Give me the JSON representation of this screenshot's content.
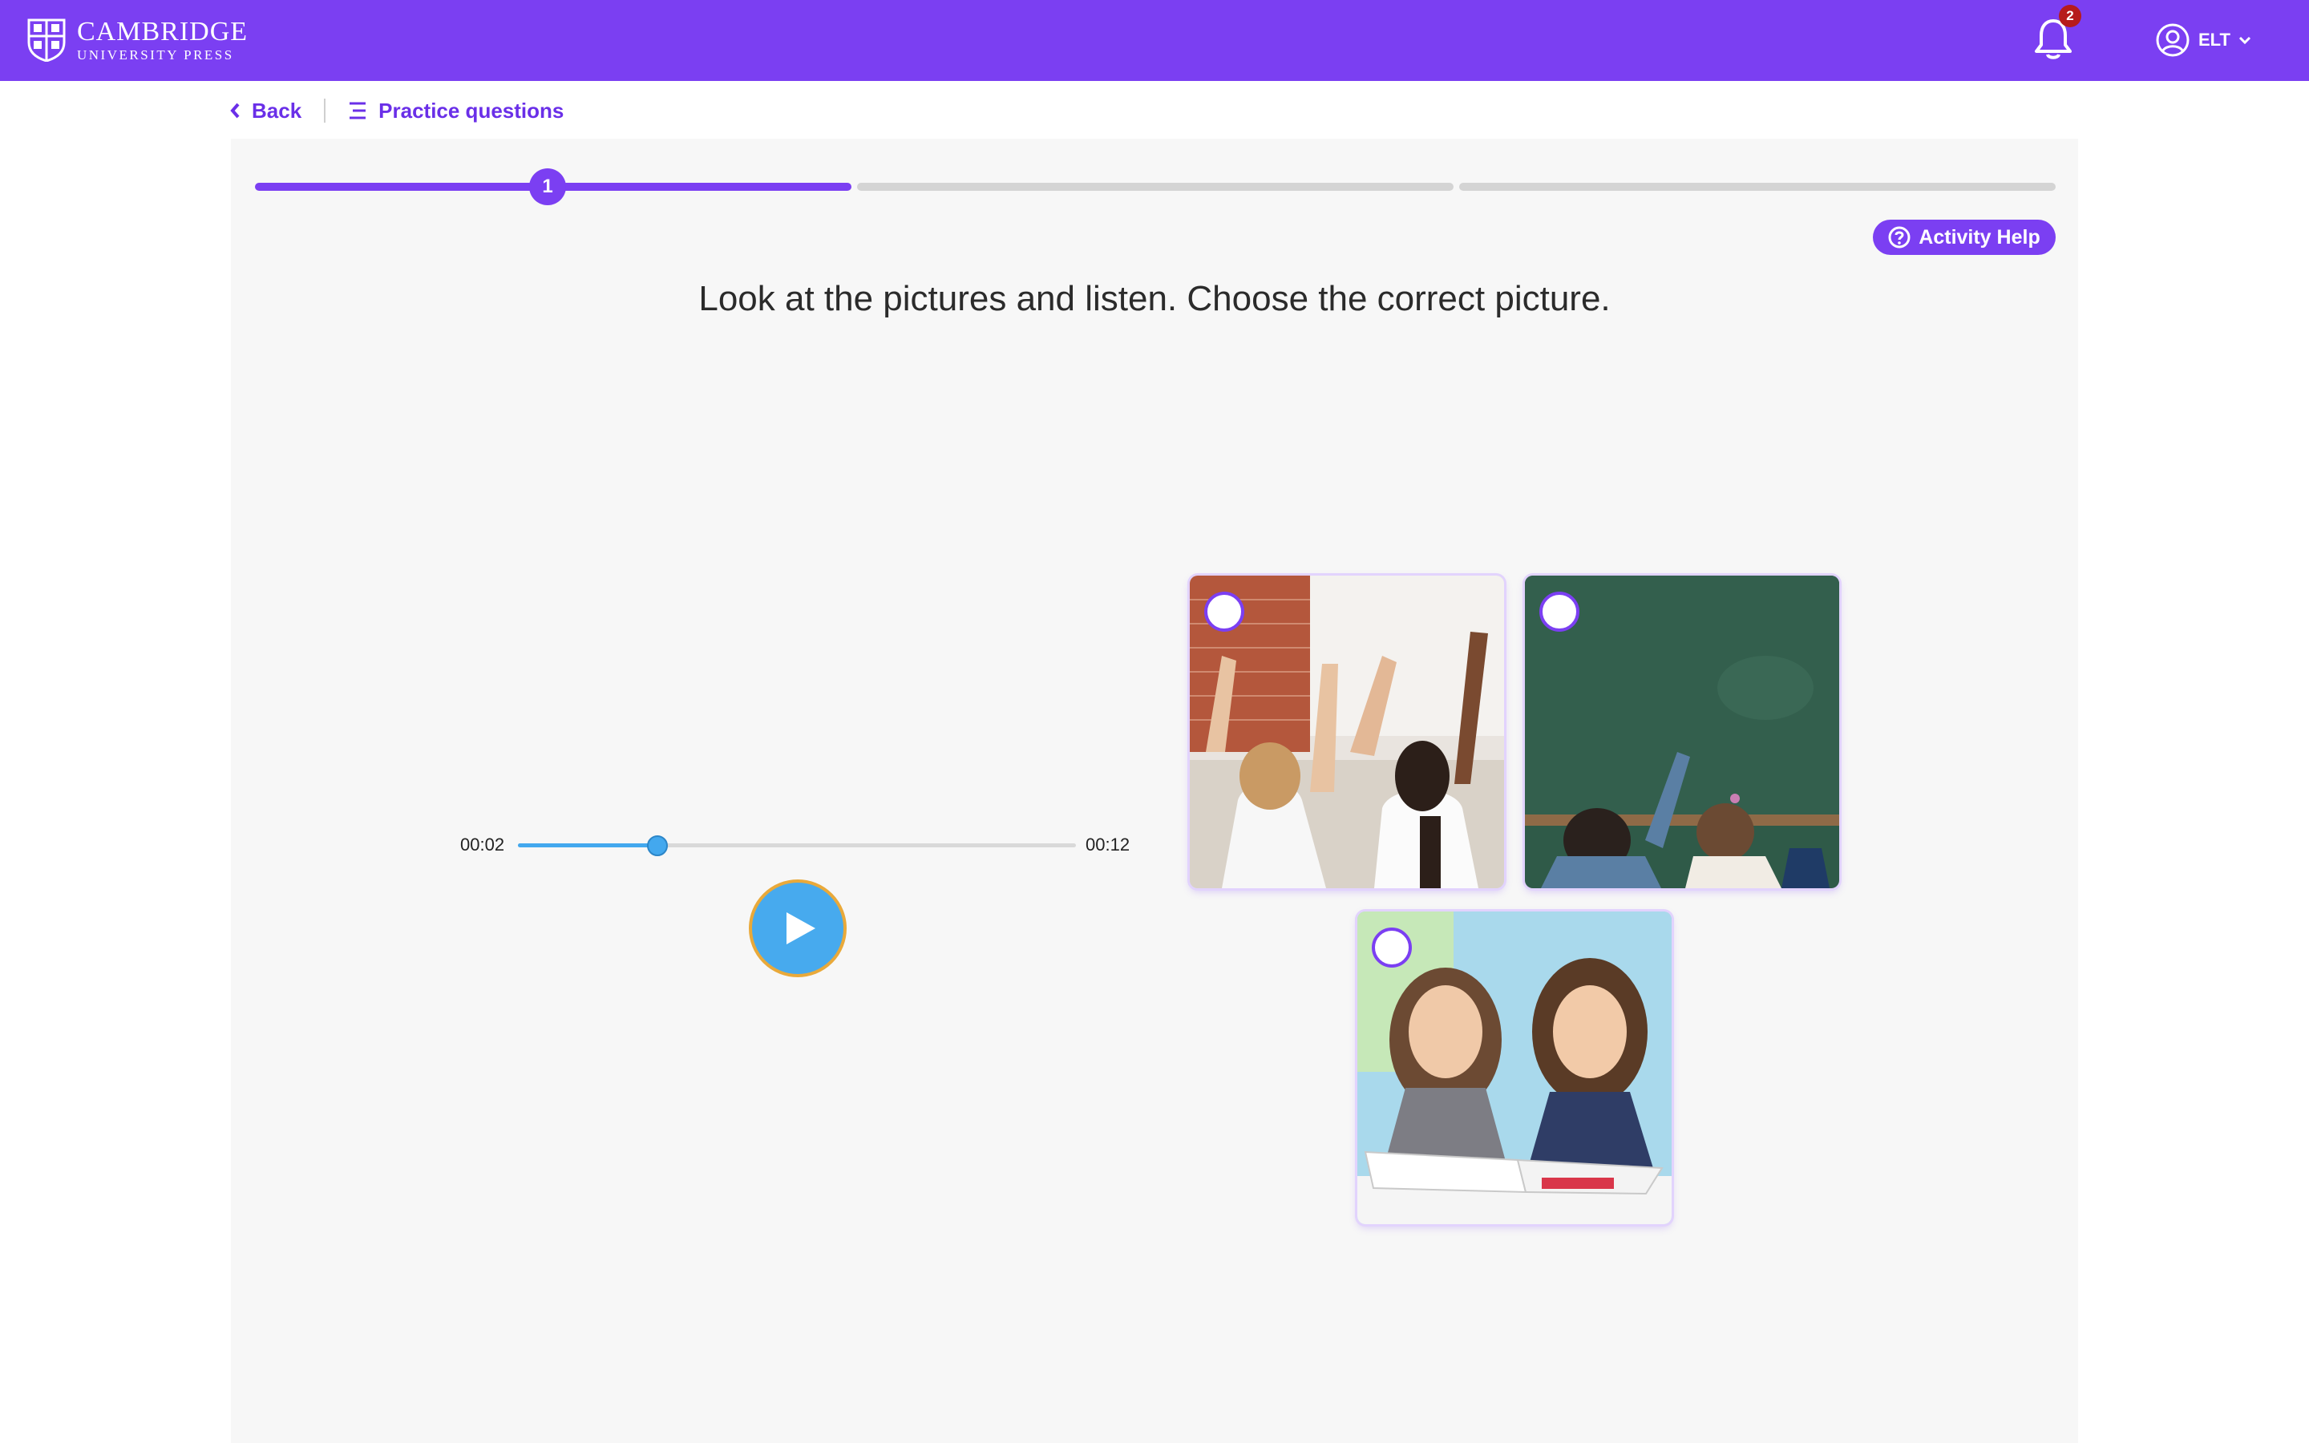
{
  "header": {
    "brand_line1": "Cambridge",
    "brand_line2": "University Press",
    "notification_count": "2",
    "user_label": "ELT"
  },
  "subnav": {
    "back_label": "Back",
    "practice_label": "Practice questions"
  },
  "activity": {
    "current_step": "1",
    "total_steps": 3,
    "help_label": "Activity Help",
    "instruction": "Look at the pictures and listen. Choose the correct picture."
  },
  "audio": {
    "current_time": "00:02",
    "total_time": "00:12",
    "progress_fraction": 0.25
  },
  "options": [
    {
      "icon": "classroom-raised-hands-photo",
      "selected": false
    },
    {
      "icon": "children-at-chalkboard-photo",
      "selected": false
    },
    {
      "icon": "girls-reading-book-photo",
      "selected": false
    }
  ],
  "colors": {
    "brand": "#7b3ff2",
    "audio_accent": "#43a8ee",
    "play_ring": "#e9a93a",
    "badge": "#b61b1b"
  }
}
